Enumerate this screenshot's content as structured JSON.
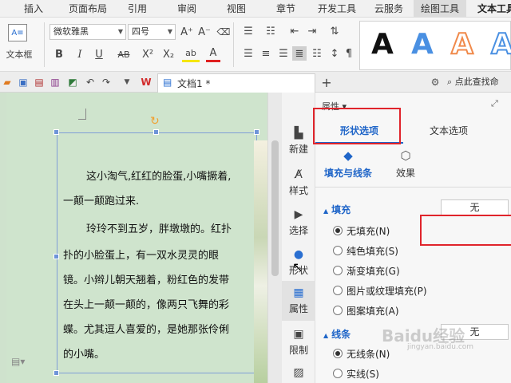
{
  "menu": {
    "tabs": [
      "插入",
      "页面布局",
      "引用",
      "审阅",
      "视图",
      "章节",
      "开发工具",
      "云服务",
      "绘图工具",
      "文本工具"
    ]
  },
  "ribbon": {
    "textbox_label": "文本框",
    "font_name": "微软雅黑",
    "font_size": "四号",
    "grow_font": "A⁺",
    "shrink_font": "A⁻",
    "bold": "B",
    "italic": "I",
    "underline": "U",
    "strike": "AB",
    "superscript": "X²",
    "subscript": "X₂",
    "highlight_letter": "ab",
    "font_color_letter": "A",
    "style_letters": [
      "A",
      "A",
      "A",
      "A"
    ],
    "style_colors": [
      "#111111",
      "#4a90e2",
      "#f08a4b",
      "#4a90e2"
    ]
  },
  "quickbar": {
    "doc_tab": "文档1 *",
    "add_tab": "+",
    "search_cmd": "点此查找命"
  },
  "document": {
    "lines": [
      "这小淘气,红红的脸蛋,小嘴撅着,",
      "一颠一颠跑过来.",
      "玲玲不到五岁，胖墩墩的。红扑",
      "扑的小脸蛋上，有一双水灵灵的眼",
      "镜。小辫儿朝天翘着，粉红色的发带",
      "在头上一颠一颠的，像两只飞舞的彩",
      "蝶。尤其逗人喜爱的，是她那张伶俐",
      "的小嘴。"
    ]
  },
  "sidebar": {
    "items": [
      {
        "label": "新建",
        "icon": "new-icon"
      },
      {
        "label": "样式",
        "icon": "style-icon"
      },
      {
        "label": "选择",
        "icon": "select-icon"
      },
      {
        "label": "形状",
        "icon": "shape-icon"
      },
      {
        "label": "属性",
        "icon": "properties-icon"
      },
      {
        "label": "限制",
        "icon": "restrict-icon"
      },
      {
        "label": "",
        "icon": "image-icon"
      }
    ]
  },
  "panel": {
    "title": "属性",
    "tab_shape": "形状选项",
    "tab_text": "文本选项",
    "subtab_fill": "填充与线条",
    "subtab_effect": "效果",
    "fill_section": "填充",
    "fill_value": "无",
    "fill_options": [
      {
        "label": "无填充(N)",
        "checked": true
      },
      {
        "label": "纯色填充(S)",
        "checked": false
      },
      {
        "label": "渐变填充(G)",
        "checked": false
      },
      {
        "label": "图片或纹理填充(P)",
        "checked": false
      },
      {
        "label": "图案填充(A)",
        "checked": false
      }
    ],
    "line_section": "线条",
    "line_value": "无",
    "line_options": [
      {
        "label": "无线条(N)",
        "checked": true
      },
      {
        "label": "实线(S)",
        "checked": false
      }
    ]
  },
  "watermark": {
    "brand": "Baidu经验",
    "url": "jingyan.baidu.com"
  }
}
